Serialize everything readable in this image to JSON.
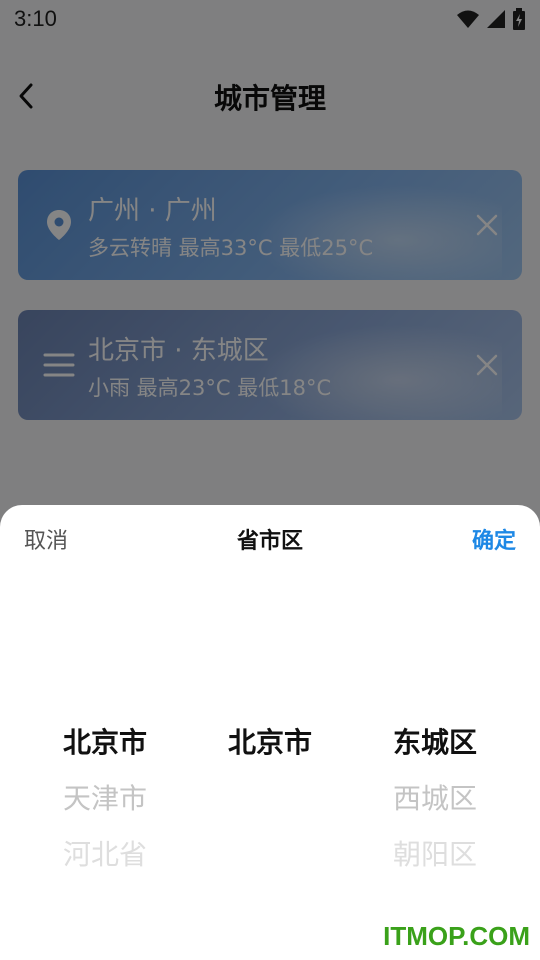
{
  "status_bar": {
    "time": "3:10"
  },
  "header": {
    "title": "城市管理"
  },
  "cities": [
    {
      "name": "广州 · 广州",
      "weather": "多云转晴  最高33°C  最低25°C"
    },
    {
      "name": "北京市 · 东城区",
      "weather": "小雨  最高23°C  最低18°C"
    }
  ],
  "picker": {
    "cancel": "取消",
    "title": "省市区",
    "confirm": "确定",
    "provinces": [
      "北京市",
      "天津市",
      "河北省"
    ],
    "cities": [
      "北京市"
    ],
    "districts": [
      "东城区",
      "西城区",
      "朝阳区"
    ]
  },
  "watermark": "ITMOP.COM",
  "colors": {
    "accent": "#1e88e5",
    "watermark": "#3aa11a"
  }
}
